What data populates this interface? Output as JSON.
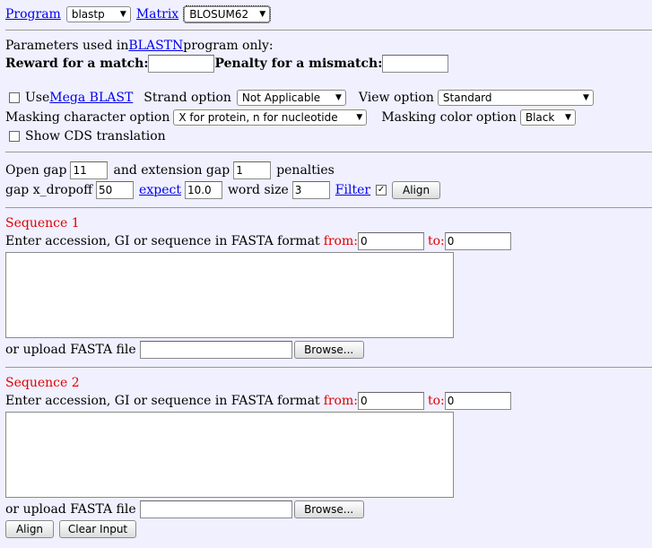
{
  "program": {
    "label": "Program",
    "value": "blastp"
  },
  "matrix": {
    "label": "Matrix",
    "value": "BLOSUM62"
  },
  "params_note": {
    "prefix": "Parameters used in ",
    "link": "BLASTN",
    "suffix": " program only:"
  },
  "reward": {
    "label": "Reward for a match:",
    "value": ""
  },
  "penalty": {
    "label": "Penalty for a mismatch:",
    "value": ""
  },
  "mega_blast": {
    "prefix": "Use ",
    "link": "Mega BLAST",
    "checked": false
  },
  "strand": {
    "label": "Strand option",
    "value": "Not Applicable"
  },
  "view": {
    "label": "View option",
    "value": "Standard"
  },
  "masking_char": {
    "label": "Masking character option",
    "value": "X for protein, n for nucleotide"
  },
  "masking_color": {
    "label": "Masking color option",
    "value": "Black"
  },
  "cds": {
    "label": "Show CDS translation",
    "checked": false
  },
  "open_gap": {
    "label": "Open gap",
    "value": "11"
  },
  "ext_gap": {
    "label": "and extension gap",
    "value": "1",
    "suffix": "penalties"
  },
  "x_dropoff": {
    "label": "gap x_dropoff",
    "value": "50"
  },
  "expect": {
    "label": "expect",
    "value": "10.0"
  },
  "word_size": {
    "label": "word size",
    "value": "3"
  },
  "filter": {
    "label": "Filter",
    "checked": true,
    "check_mark": "✓"
  },
  "align_top": "Align",
  "seq1": {
    "title": "Sequence 1",
    "enter_label": "Enter accession, GI or sequence in FASTA format",
    "from_label": "from:",
    "from_value": "0",
    "to_label": "to:",
    "to_value": "0",
    "upload_label": "or upload FASTA file",
    "browse": "Browse..."
  },
  "seq2": {
    "title": "Sequence 2",
    "enter_label": "Enter accession, GI or sequence in FASTA format",
    "from_label": "from:",
    "from_value": "0",
    "to_label": "to:",
    "to_value": "0",
    "upload_label": "or upload FASTA file",
    "browse": "Browse..."
  },
  "bottom": {
    "align": "Align",
    "clear": "Clear Input"
  },
  "arrow_glyph": "▼"
}
